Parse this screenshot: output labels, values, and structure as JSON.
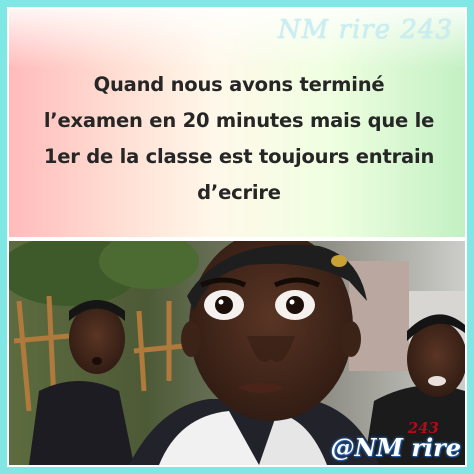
{
  "watermark_top": "NM rire 243",
  "caption": {
    "lines": [
      "Quand nous avons terminé",
      "l’examen en 20 minutes mais que le",
      "1er de la classe est toujours entrain",
      "d’ecrire"
    ]
  },
  "watermark_bottom": {
    "small": "243",
    "main": "@NM rire"
  },
  "colors": {
    "frame_border": "#7fe7e4",
    "caption_text": "#262626",
    "watermark_red": "#b50a1a",
    "watermark_blue": "#2a6bbd"
  }
}
